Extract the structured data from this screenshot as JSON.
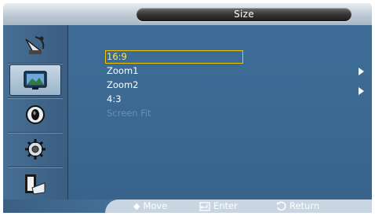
{
  "header": {
    "title": "Size"
  },
  "sidebar": {
    "items": [
      {
        "icon": "satellite-dish-icon"
      },
      {
        "icon": "picture-icon"
      },
      {
        "icon": "sound-icon"
      },
      {
        "icon": "setup-gear-icon"
      },
      {
        "icon": "input-icon"
      }
    ],
    "active_index": 1
  },
  "menu": {
    "items": [
      {
        "label": "16:9",
        "selected": true,
        "enabled": true,
        "submenu": false
      },
      {
        "label": "Zoom1",
        "selected": false,
        "enabled": true,
        "submenu": true
      },
      {
        "label": "Zoom2",
        "selected": false,
        "enabled": true,
        "submenu": true
      },
      {
        "label": "4:3",
        "selected": false,
        "enabled": true,
        "submenu": false
      },
      {
        "label": "Screen Fit",
        "selected": false,
        "enabled": false,
        "submenu": false
      }
    ]
  },
  "footer": {
    "move_icon": "up-down-arrow-icon",
    "move_label": "Move",
    "enter_icon": "enter-icon",
    "enter_label": "Enter",
    "return_icon": "return-icon",
    "return_label": "Return"
  },
  "colors": {
    "accent": "#f1c400",
    "panel": "#3b6992",
    "sidebar": "#3f6488",
    "title_pill": "#2a2a2a"
  }
}
